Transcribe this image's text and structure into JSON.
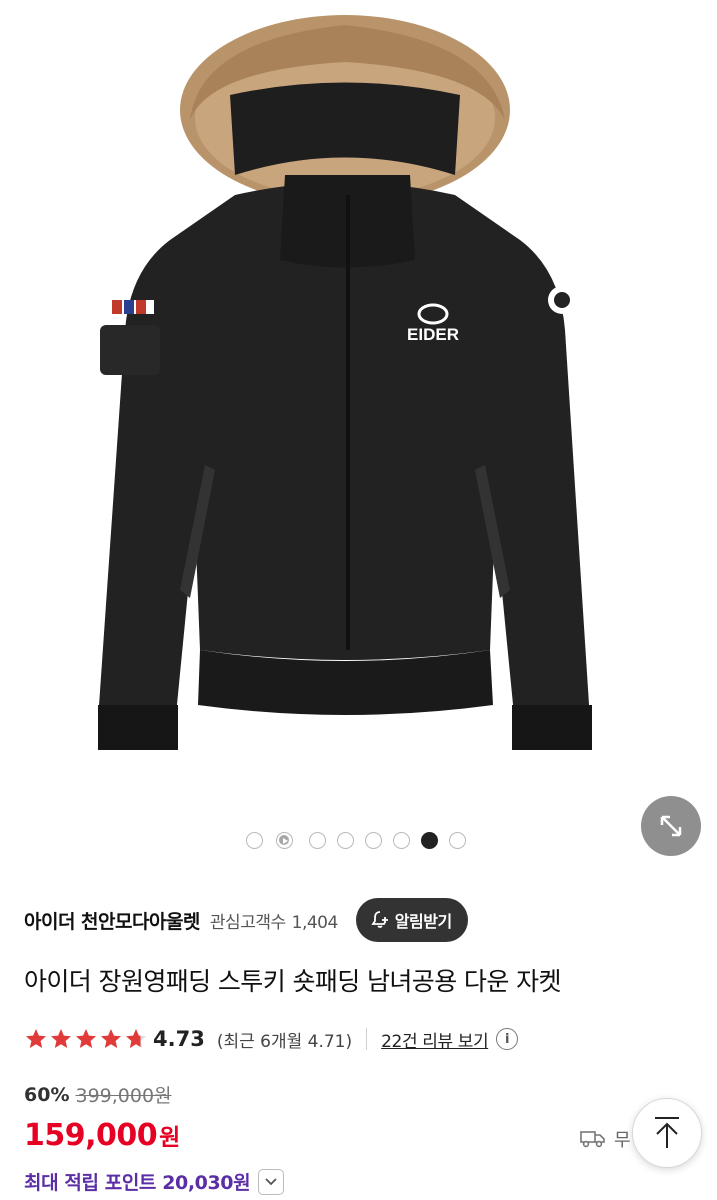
{
  "product_image": {
    "brand_mark": "EIDER"
  },
  "gallery": {
    "total": 8,
    "active_index": 6,
    "video_index": 1
  },
  "store": {
    "name": "아이더 천안모다아울렛",
    "followers_label": "관심고객수",
    "followers_count": "1,404",
    "alarm_label": "알림받기"
  },
  "product": {
    "title": "아이더 장원영패딩 스투키 숏패딩 남녀공용 다운 자켓"
  },
  "rating": {
    "value": "4.73",
    "stars": 4.73,
    "recent": "(최근 6개월 4.71)",
    "review_link": "22건 리뷰 보기",
    "info": "i"
  },
  "pricing": {
    "discount": "60%",
    "original": "399,000원",
    "price": "159,000",
    "currency": "원"
  },
  "shipping": {
    "label": "무"
  },
  "points": {
    "label": "최대 적립 포인트 20,030원"
  },
  "colors": {
    "price": "#e60023",
    "points": "#5b2ea6",
    "star": "#e13a3a"
  }
}
